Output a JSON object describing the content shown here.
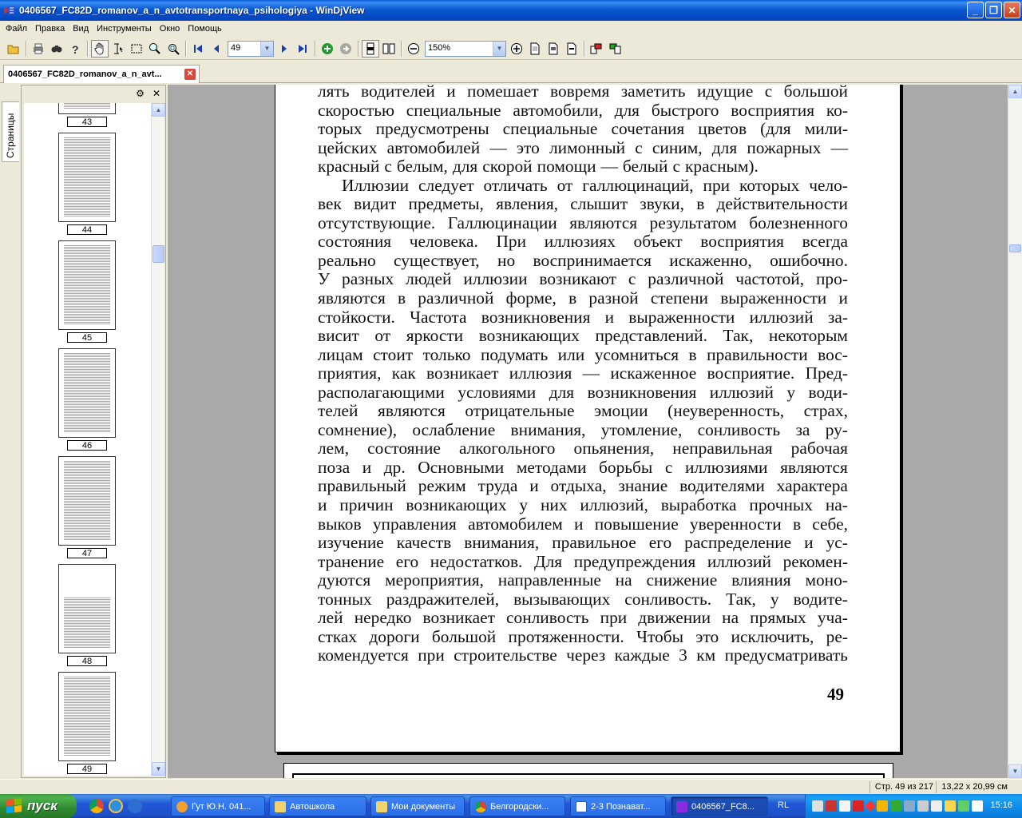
{
  "window": {
    "title": "0406567_FC82D_romanov_a_n_avtotransportnaya_psihologiya - WinDjView",
    "buttons": [
      "minimize",
      "maximize",
      "close"
    ]
  },
  "menu": [
    "Файл",
    "Правка",
    "Вид",
    "Инструменты",
    "Окно",
    "Помощь"
  ],
  "toolbar": {
    "page_value": "49",
    "zoom_value": "150%",
    "icons": [
      "open-icon",
      "print-icon",
      "find-icon",
      "help-icon",
      "hand-icon",
      "text-select-icon",
      "rect-select-icon",
      "zoom-icon",
      "zoom-rect-icon",
      "first-page-icon",
      "prev-page-icon",
      "next-page-icon",
      "last-page-icon",
      "back-icon",
      "forward-icon",
      "single-page-icon",
      "two-page-icon",
      "zoom-out-icon",
      "zoom-in-icon",
      "fit-page-icon",
      "fit-width-icon",
      "rotate-left-icon",
      "rotate-right-icon"
    ]
  },
  "tab": {
    "label": "0406567_FC82D_romanov_a_n_avt..."
  },
  "sidebar": {
    "vertical_tab": "Страницы",
    "thumbnails": [
      {
        "page": "43"
      },
      {
        "page": "44"
      },
      {
        "page": "45"
      },
      {
        "page": "46"
      },
      {
        "page": "47"
      },
      {
        "page": "48"
      },
      {
        "page": "49"
      }
    ]
  },
  "document": {
    "lines": [
      "лять водителей и помешает вовремя заметить идущие с большой",
      "скоростью специальные автомобили, для быстрого восприятия ко-",
      "торых предусмотрены специальные сочетания цветов (для мили-",
      "цейских автомобилей — это лимонный с синим, для пожарных —",
      "красный с белым, для скорой помощи — белый с красным).",
      "Иллюзии следует отличать от галлюцинаций, при которых чело-",
      "век видит предметы, явления, слышит звуки, в действительности",
      "отсутствующие. Галлюцинации являются результатом болезненного",
      "состояния человека. При иллюзиях объект восприятия всегда",
      "реально существует, но воспринимается искаженно, ошибочно.",
      "У разных людей иллюзии возникают с различной частотой, про-",
      "являются в различной форме, в разной степени выраженности и",
      "стойкости. Частота возникновения и выраженности иллюзий за-",
      "висит от яркости возникающих представлений. Так, некоторым",
      "лицам стоит только подумать или усомниться в правильности вос-",
      "приятия, как возникает иллюзия — искаженное восприятие. Пред-",
      "располагающими условиями для возникновения иллюзий у води-",
      "телей являются отрицательные эмоции (неуверенность, страх,",
      "сомнение), ослабление внимания, утомление, сонливость за ру-",
      "лем, состояние алкогольного опьянения, неправильная рабочая",
      "поза и др. Основными методами борьбы с иллюзиями являются",
      "правильный режим труда и отдыха, знание водителями характера",
      "и причин возникающих у них иллюзий, выработка прочных на-",
      "выков управления автомобилем и повышение уверенности в себе,",
      "изучение качеств внимания, правильное его распределение и ус-",
      "транение его недостатков. Для предупреждения иллюзий рекомен-",
      "дуются мероприятия, направленные на снижение влияния моно-",
      "тонных раздражителей, вызывающих сонливость. Так, у водите-",
      "лей нередко возникает сонливость при движении на прямых уча-",
      "стках дороги большой протяженности. Чтобы это исключить, ре-",
      "комендуется при строительстве через каждые 3 км предусматривать"
    ],
    "page_number": "49"
  },
  "status": {
    "page_info": "Стр. 49 из 217",
    "size_info": "13,22 x 20,99 см"
  },
  "taskbar": {
    "start_label": "пуск",
    "tasks": [
      {
        "label": "Гут Ю.Н. 041...",
        "icon_color": "#f0a030"
      },
      {
        "label": "Автошкола",
        "icon_color": "#f2d36b"
      },
      {
        "label": "Мои документы",
        "icon_color": "#f2d36b"
      },
      {
        "label": "Белгородски...",
        "icon_color": "#4caf50"
      },
      {
        "label": "2-3 Познават...",
        "icon_color": "#2b5fb4"
      },
      {
        "label": "0406567_FC8...",
        "icon_color": "#8a2be2"
      }
    ],
    "language": "RL",
    "clock": "15:16"
  }
}
